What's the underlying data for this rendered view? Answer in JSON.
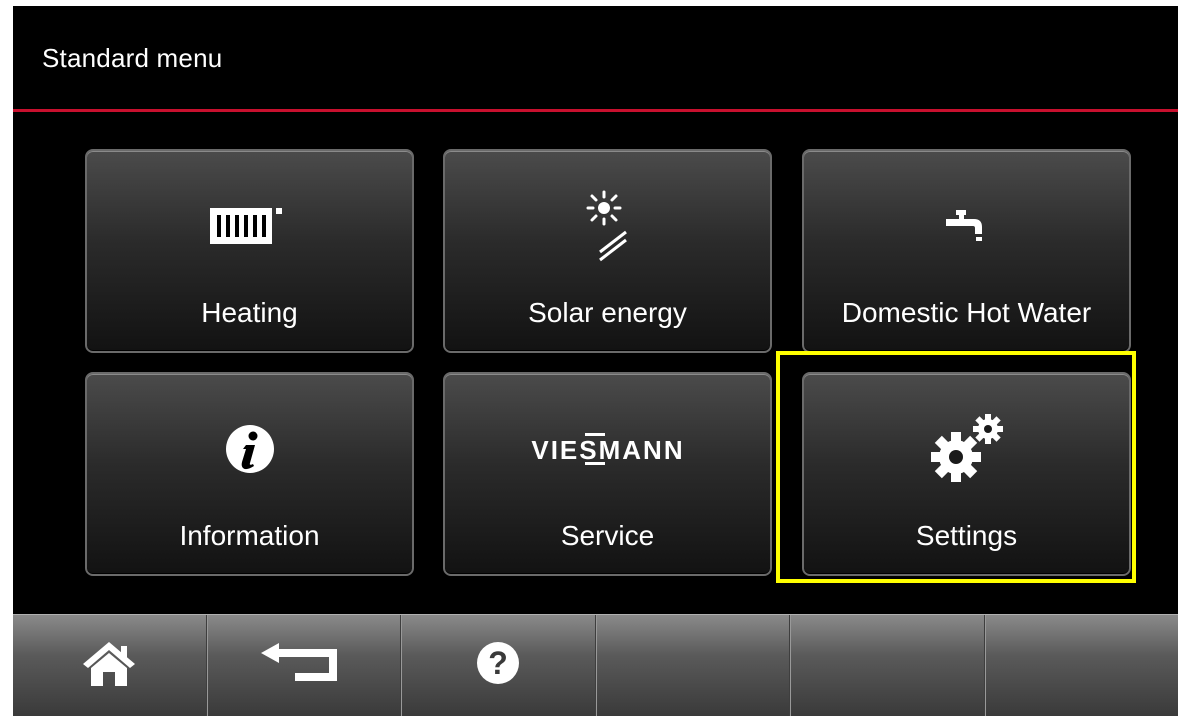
{
  "header": {
    "title": "Standard menu"
  },
  "tiles": [
    {
      "label": "Heating",
      "icon": "radiator-icon"
    },
    {
      "label": "Solar energy",
      "icon": "solar-collector-icon"
    },
    {
      "label": "Domestic Hot Water",
      "icon": "tap-icon"
    },
    {
      "label": "Information",
      "icon": "info-icon"
    },
    {
      "label": "Service",
      "icon": "brand-logo",
      "logo_text": "VIESMANN"
    },
    {
      "label": "Settings",
      "icon": "gears-icon"
    }
  ],
  "footer": {
    "buttons": [
      {
        "icon": "home-icon"
      },
      {
        "icon": "back-icon"
      },
      {
        "icon": "help-icon",
        "glyph": "?"
      },
      {
        "icon": ""
      },
      {
        "icon": ""
      },
      {
        "icon": ""
      }
    ]
  },
  "colors": {
    "accent": "#c8102e",
    "highlight": "#ffff00",
    "background": "#000000"
  }
}
